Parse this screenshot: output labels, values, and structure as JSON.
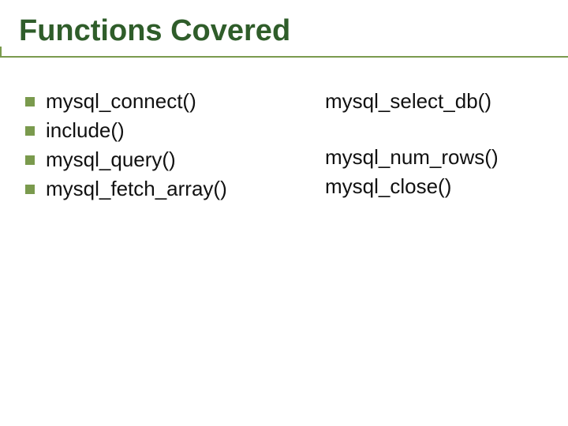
{
  "title": "Functions Covered",
  "left_items": [
    "mysql_connect()",
    "include()",
    "mysql_query()",
    "mysql_fetch_array()"
  ],
  "right_items": [
    "mysql_select_db()",
    "",
    "mysql_num_rows()",
    "mysql_close()"
  ]
}
